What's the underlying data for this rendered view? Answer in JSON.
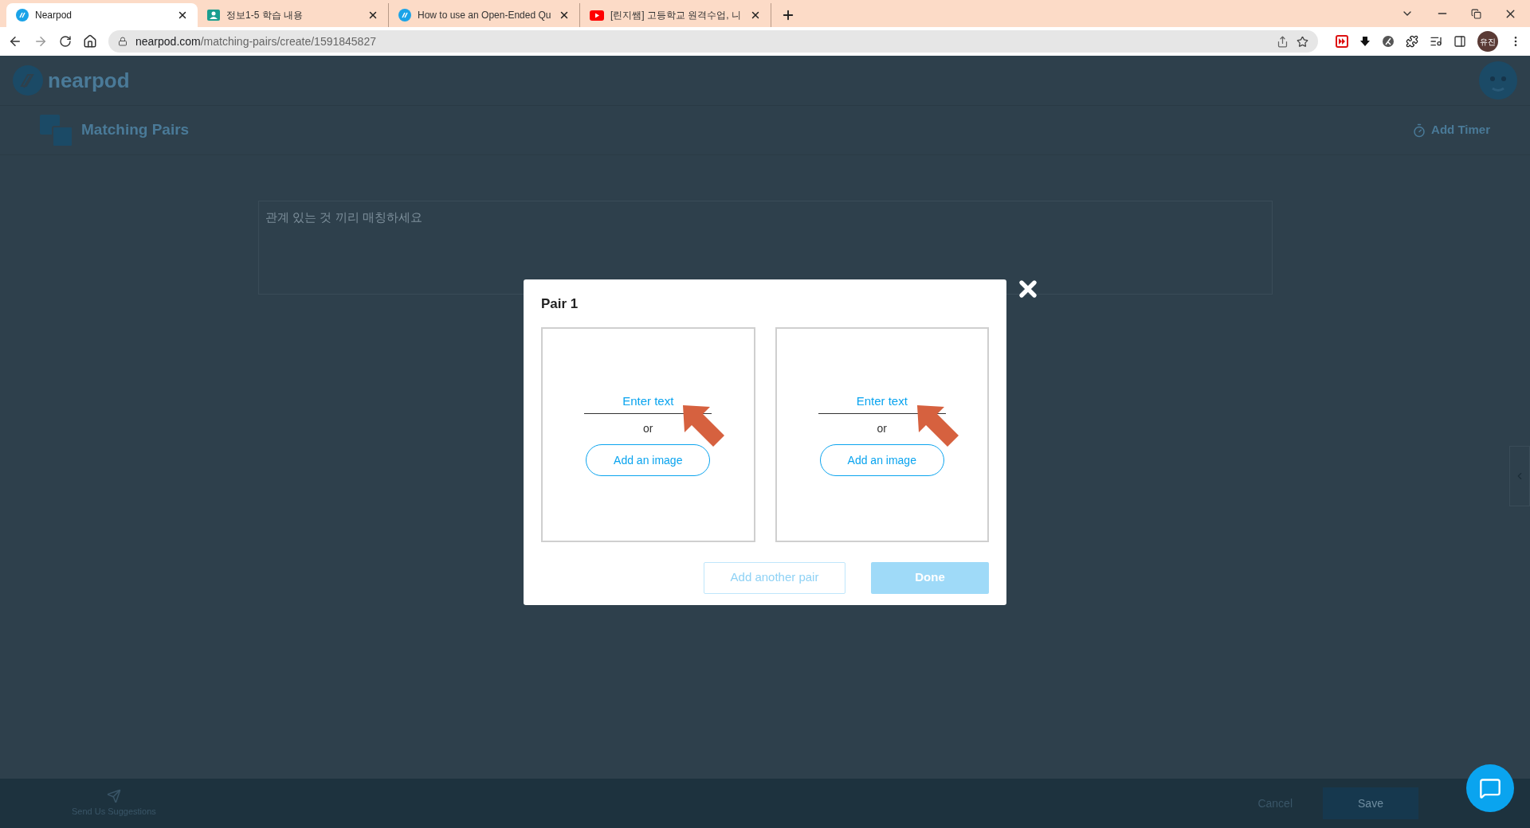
{
  "browser": {
    "tabs": [
      {
        "title": "Nearpod",
        "kind": "nearpod",
        "selected": true
      },
      {
        "title": "정보1-5 학습 내용",
        "kind": "classroom",
        "selected": false
      },
      {
        "title": "How to use an Open-Ended Qu",
        "kind": "nearpod",
        "selected": false
      },
      {
        "title": "[린지쌤] 고등학교 원격수업, 니",
        "kind": "youtube",
        "selected": false
      }
    ],
    "address": {
      "host": "nearpod.com",
      "path": "/matching-pairs/create/1591845827"
    },
    "profile": "유진"
  },
  "app": {
    "logo": "nearpod",
    "activity": "Matching Pairs",
    "add_timer": "Add Timer",
    "question": "관계 있는 것 끼리 매칭하세요"
  },
  "modal": {
    "title": "Pair 1",
    "cards": [
      {
        "placeholder": "Enter text",
        "or": "or",
        "image_button": "Add an image"
      },
      {
        "placeholder": "Enter text",
        "or": "or",
        "image_button": "Add an image"
      }
    ],
    "buttons": [
      {
        "kind": "secondary",
        "label": "Add another pair",
        "disabled": true
      },
      {
        "kind": "primary",
        "label": "Done",
        "disabled": true
      }
    ]
  },
  "footer": {
    "suggestions": "Send Us Suggestions",
    "cancel": "Cancel",
    "save": "Save"
  }
}
